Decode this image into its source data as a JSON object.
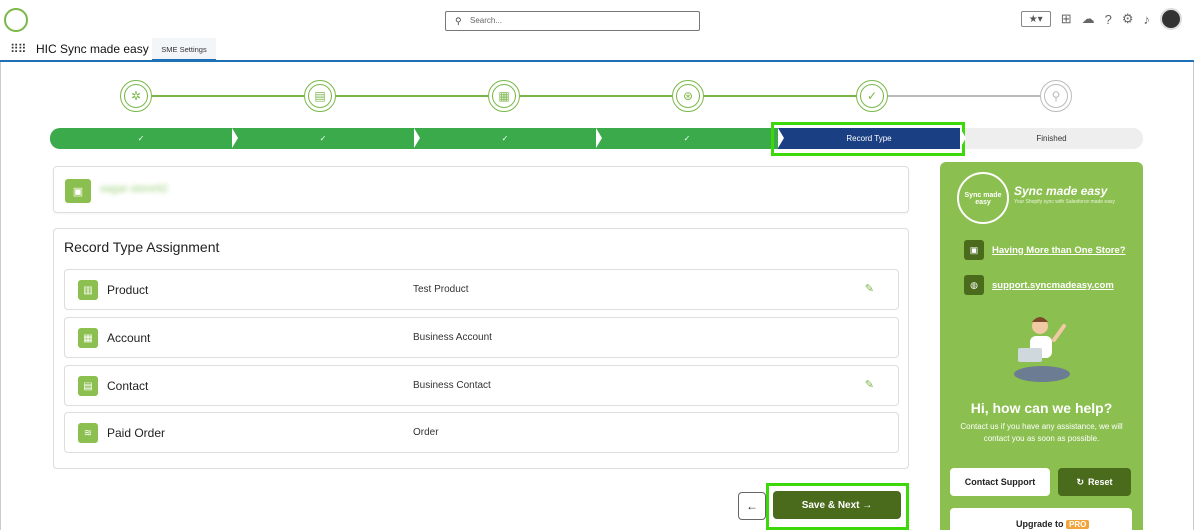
{
  "header": {
    "search_placeholder": "Search...",
    "search_icon": "search-icon",
    "icons": [
      "star-icon",
      "add-icon",
      "cloud-icon",
      "help-icon",
      "gear-icon",
      "bell-icon",
      "avatar"
    ]
  },
  "nav": {
    "app_name": "HIC Sync made easy",
    "tab": "SME Settings"
  },
  "wizard": {
    "step_icons": [
      "gears-icon",
      "id-card-icon",
      "profile-icon",
      "network-icon",
      "clipboard-check-icon",
      "plug-icon"
    ],
    "steps": [
      {
        "label": "✓",
        "status": "done"
      },
      {
        "label": "✓",
        "status": "done"
      },
      {
        "label": "✓",
        "status": "done"
      },
      {
        "label": "✓",
        "status": "done"
      },
      {
        "label": "Record Type",
        "status": "current"
      },
      {
        "label": "Finished",
        "status": "pending"
      }
    ]
  },
  "store": {
    "name": "sagar-store92",
    "icon": "store-icon"
  },
  "record_type_assignment": {
    "title": "Record Type Assignment",
    "rows": [
      {
        "label": "Product",
        "value": "Test Product",
        "icon": "barcode-icon",
        "editable": true
      },
      {
        "label": "Account",
        "value": "Business Account",
        "icon": "building-icon",
        "editable": false
      },
      {
        "label": "Contact",
        "value": "Business Contact",
        "icon": "contact-card-icon",
        "editable": true
      },
      {
        "label": "Paid Order",
        "value": "Order",
        "icon": "layers-icon",
        "editable": false
      }
    ]
  },
  "actions": {
    "back": "←",
    "save_next": "Save & Next →"
  },
  "sidebar": {
    "logo_text": "Sync made easy",
    "brand": "Sync made easy",
    "tagline": "Your Shopify sync with Salesforce made easy",
    "link_stores": "Having More than One Store?",
    "link_support": "support.syncmadeasy.com",
    "help_title": "Hi, how can we help?",
    "help_text": "Contact us if you have any assistance, we will contact you as soon as possible.",
    "contact_button": "Contact Support",
    "reset_button": "Reset",
    "upgrade_text": "Upgrade to",
    "upgrade_badge": "PRO"
  },
  "colors": {
    "brand_green": "#8bbf4f",
    "dark_green": "#4a6a1c",
    "done_green": "#3aaa4a",
    "current_navy": "#1a3f82",
    "highlight": "#3cd80a"
  }
}
